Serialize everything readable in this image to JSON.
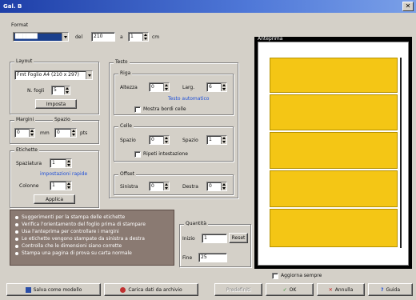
{
  "window": {
    "title": "Gal. B",
    "close_glyph": "✕"
  },
  "header": {
    "label": "Format",
    "combo_value": "██████",
    "width_label": "del",
    "width_value": "210",
    "height_label": "a",
    "height_value": "1",
    "height_unit": "cm"
  },
  "left": {
    "group1": {
      "title": "Layout",
      "select_value": "Fmt Foglio A4 (210 x 297)",
      "num_label": "N. fogli",
      "num_value": "5",
      "button": "Imposta"
    },
    "group2": {
      "title": "Margini",
      "title2": "Spazio",
      "val1": "0",
      "label2": "mm",
      "val2": "0",
      "unit2": "pts"
    },
    "group3": {
      "title": "Etichette",
      "label1": "Spaziatura",
      "val1": "1",
      "link": "impostazioni rapide",
      "label2": "Colonne",
      "val2": "1",
      "button": "Applica"
    }
  },
  "middle": {
    "title": "Testo",
    "g1": {
      "title": "Riga",
      "l1": "Altezza",
      "v1": "0",
      "l2": "Larg.",
      "v2": "6",
      "link": "Testo automatico",
      "check": "Mostra bordi celle"
    },
    "g2": {
      "title": "Celle",
      "l1": "Spazio",
      "v1": "0",
      "l2": "Spazio",
      "v2": "1",
      "check": "Ripeti intestazione"
    },
    "g3": {
      "title": "Offset",
      "l1": "Sinistra",
      "v1": "0",
      "l2": "Destra",
      "v2": "0"
    }
  },
  "info": {
    "title": "Suggerimenti per la stampa delle etichette",
    "lines": [
      "Verifica l'orientamento del foglio prima di stampare",
      "Usa l'anteprima per controllare i margini",
      "Le etichette vengono stampate da sinistra a destra",
      "Controlla che le dimensioni siano corrette",
      "Stampa una pagina di prova su carta normale"
    ]
  },
  "copies": {
    "title": "Quantità",
    "l1": "Inizio",
    "v1": "1",
    "button": "Reset",
    "l2": "Fine",
    "v2": "25"
  },
  "preview": {
    "title": "Anteprima",
    "check": "Aggiorna sempre",
    "panel_color": "#f4c615",
    "panels": 5
  },
  "footer": {
    "b1": "Salva come modello",
    "b2": "Carica dati da archivio",
    "b3": "Predefiniti",
    "b4": "OK",
    "b5": "Annulla",
    "b6": "Guida"
  }
}
